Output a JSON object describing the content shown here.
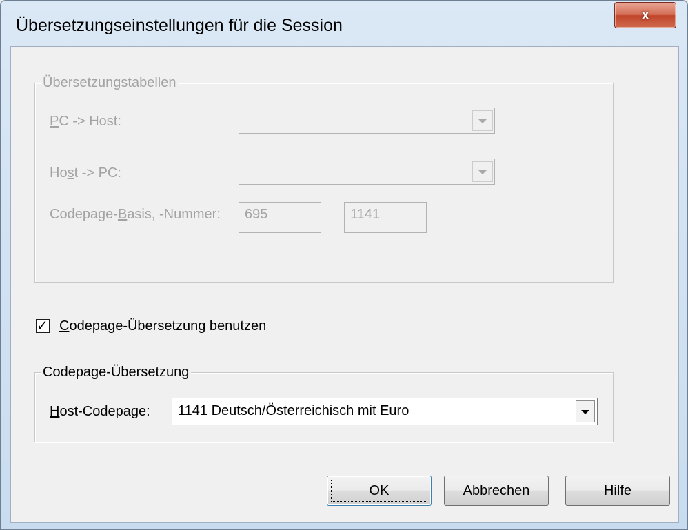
{
  "window": {
    "title": "Übersetzungseinstellungen für die Session",
    "close_glyph": "x"
  },
  "tables_group": {
    "legend": "Übersetzungstabellen",
    "pc_to_host": {
      "label_mn": "P",
      "label_rest": "C -> Host:",
      "value": ""
    },
    "host_to_pc": {
      "label_pre": "Ho",
      "label_mn": "s",
      "label_post": "t -> PC:",
      "value": ""
    },
    "codepage": {
      "label_pre": "Codepage-",
      "label_mn": "B",
      "label_post": "asis, -Nummer:",
      "basis": "695",
      "number": "1141"
    }
  },
  "use_codepage": {
    "checked": true,
    "check_glyph": "✓",
    "label_mn": "C",
    "label_rest": "odepage-Übersetzung benutzen"
  },
  "codepage_group": {
    "legend": "Codepage-Übersetzung",
    "host_codepage": {
      "label_mn": "H",
      "label_rest": "ost-Codepage:",
      "value": "1141 Deutsch/Österreichisch mit Euro"
    }
  },
  "buttons": {
    "ok": "OK",
    "cancel": "Abbrechen",
    "help": "Hilfe"
  },
  "colors": {
    "disabled_text": "#a3a3a3",
    "close_button": "#c0452b",
    "default_button_border": "#3c7fb1"
  }
}
